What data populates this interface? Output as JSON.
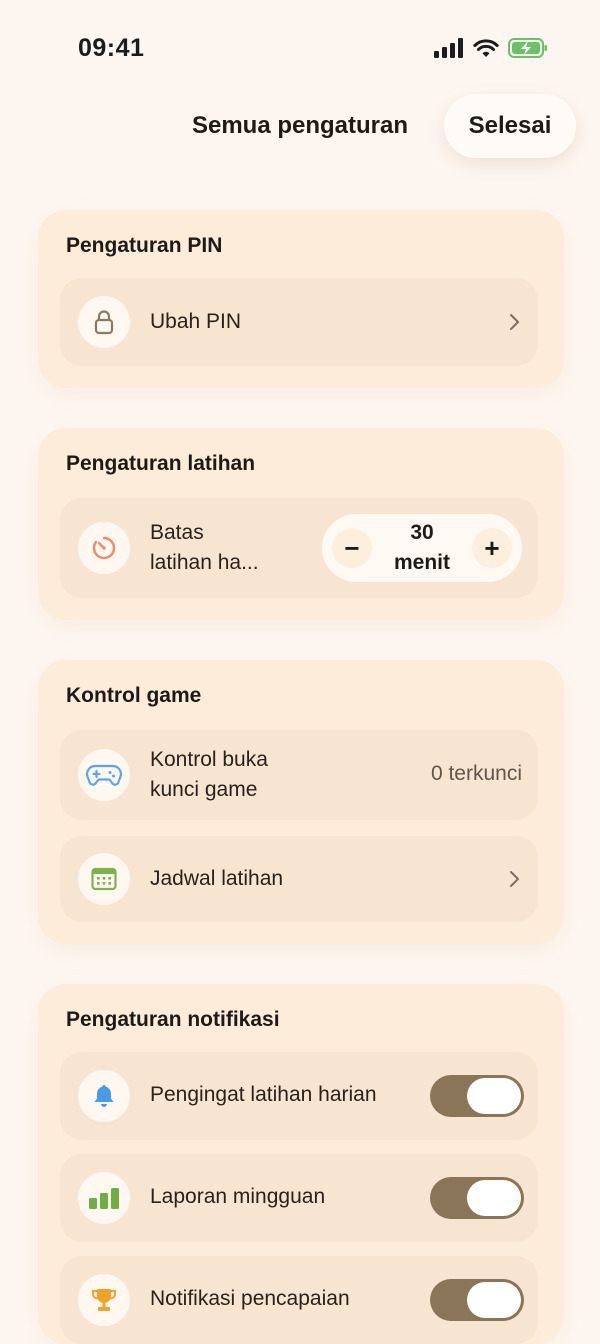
{
  "status_bar": {
    "time": "09:41"
  },
  "header": {
    "title": "Semua pengaturan",
    "done_label": "Selesai"
  },
  "pin_section": {
    "title": "Pengaturan PIN",
    "change_pin_label": "Ubah PIN"
  },
  "practice_section": {
    "title": "Pengaturan latihan",
    "limit_label_line1": "Batas",
    "limit_label_line2": "latihan ha...",
    "stepper_minus": "−",
    "stepper_plus": "+",
    "stepper_value_line1": "30",
    "stepper_value_line2": "menit"
  },
  "game_section": {
    "title": "Kontrol game",
    "unlock_label_line1": "Kontrol buka",
    "unlock_label_line2": "kunci game",
    "unlock_value": "0 terkunci",
    "schedule_label": "Jadwal latihan"
  },
  "notification_section": {
    "title": "Pengaturan notifikasi",
    "items": [
      {
        "label": "Pengingat latihan harian",
        "enabled": true,
        "icon": "bell-icon"
      },
      {
        "label": "Laporan mingguan",
        "enabled": true,
        "icon": "bar-chart-icon"
      },
      {
        "label": "Notifikasi pencapaian",
        "enabled": true,
        "icon": "trophy-icon"
      }
    ]
  },
  "colors": {
    "toggle_on": "#8a7558",
    "lock_icon": "#8b7a62",
    "timer_icon": "#f08a6a",
    "gamepad_icon": "#5aa6e8",
    "calendar_icon": "#7cb24a",
    "bell_icon": "#4a9ae6",
    "chart_icon": "#6fae45",
    "trophy_icon": "#f0a32a"
  }
}
